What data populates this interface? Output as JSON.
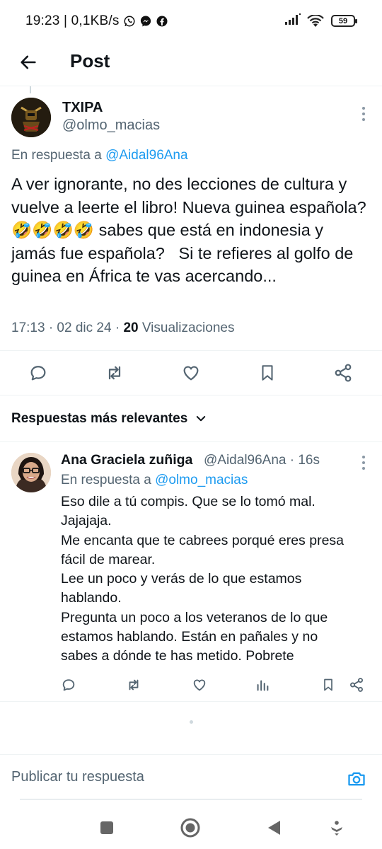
{
  "status_bar": {
    "time_speed": "19:23 | 0,1KB/s",
    "battery": "59",
    "icons": [
      "whatsapp-icon",
      "messenger-icon",
      "facebook-icon",
      "signal-icon",
      "wifi-icon",
      "battery-icon"
    ]
  },
  "header": {
    "title": "Post"
  },
  "tweet": {
    "author_name": "TXIPA",
    "author_handle": "@olmo_macias",
    "reply_prefix": "En respuesta a ",
    "reply_mention": "@Aidal96Ana",
    "text": "A ver ignorante, no des lecciones de cultura y vuelve a leerte el libro! Nueva guinea española?🤣🤣🤣🤣 sabes que está en indonesia y jamás fue española?   Si te refieres al golfo de guinea en África te vas acercando...",
    "meta_time": "17:13 · 02 dic 24 · ",
    "views_count": "20",
    "views_label": " Visualizaciones"
  },
  "tweet_actions": [
    "reply-icon",
    "retweet-icon",
    "like-icon",
    "bookmark-icon",
    "share-icon"
  ],
  "replies_section": {
    "title": "Respuestas más relevantes"
  },
  "reply": {
    "author_name": "Ana Graciela zuñiga",
    "author_handle": "@Aidal96Ana · 16s",
    "reply_prefix": "En respuesta a ",
    "reply_mention": "@olmo_macias",
    "lines": [
      "Eso dile a tú compis. Que se lo tomó mal.",
      "Jajajaja.",
      "Me encanta que te cabrees porqué eres presa",
      "fácil de marear.",
      "Lee un poco y verás de lo que estamos",
      "hablando.",
      "Pregunta un poco a los veteranos de lo que",
      "estamos hablando. Están en pañales y no",
      "sabes a dónde te has metido. Pobrete"
    ]
  },
  "compose": {
    "placeholder": "Publicar tu respuesta"
  },
  "colors": {
    "accent": "#1d9bf0",
    "secondary_text": "#536471",
    "primary_text": "#0f1419",
    "divider": "#eff3f4"
  }
}
